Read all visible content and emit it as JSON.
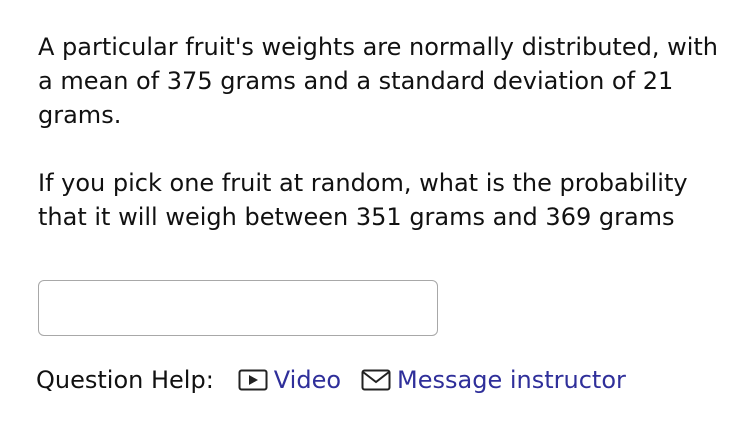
{
  "question": {
    "paragraph1": "A particular fruit's weights are normally distributed, with a mean of 375 grams and a standard deviation of 21 grams.",
    "paragraph2": "If you pick one fruit at random, what is the probability that it will weigh between 351 grams and 369 grams"
  },
  "answer": {
    "value": "",
    "placeholder": ""
  },
  "help": {
    "label": "Question Help:",
    "video_label": "Video",
    "video_icon": "video-play-icon",
    "message_label": "Message instructor",
    "message_icon": "envelope-icon",
    "link_color": "#2f2f9a"
  }
}
